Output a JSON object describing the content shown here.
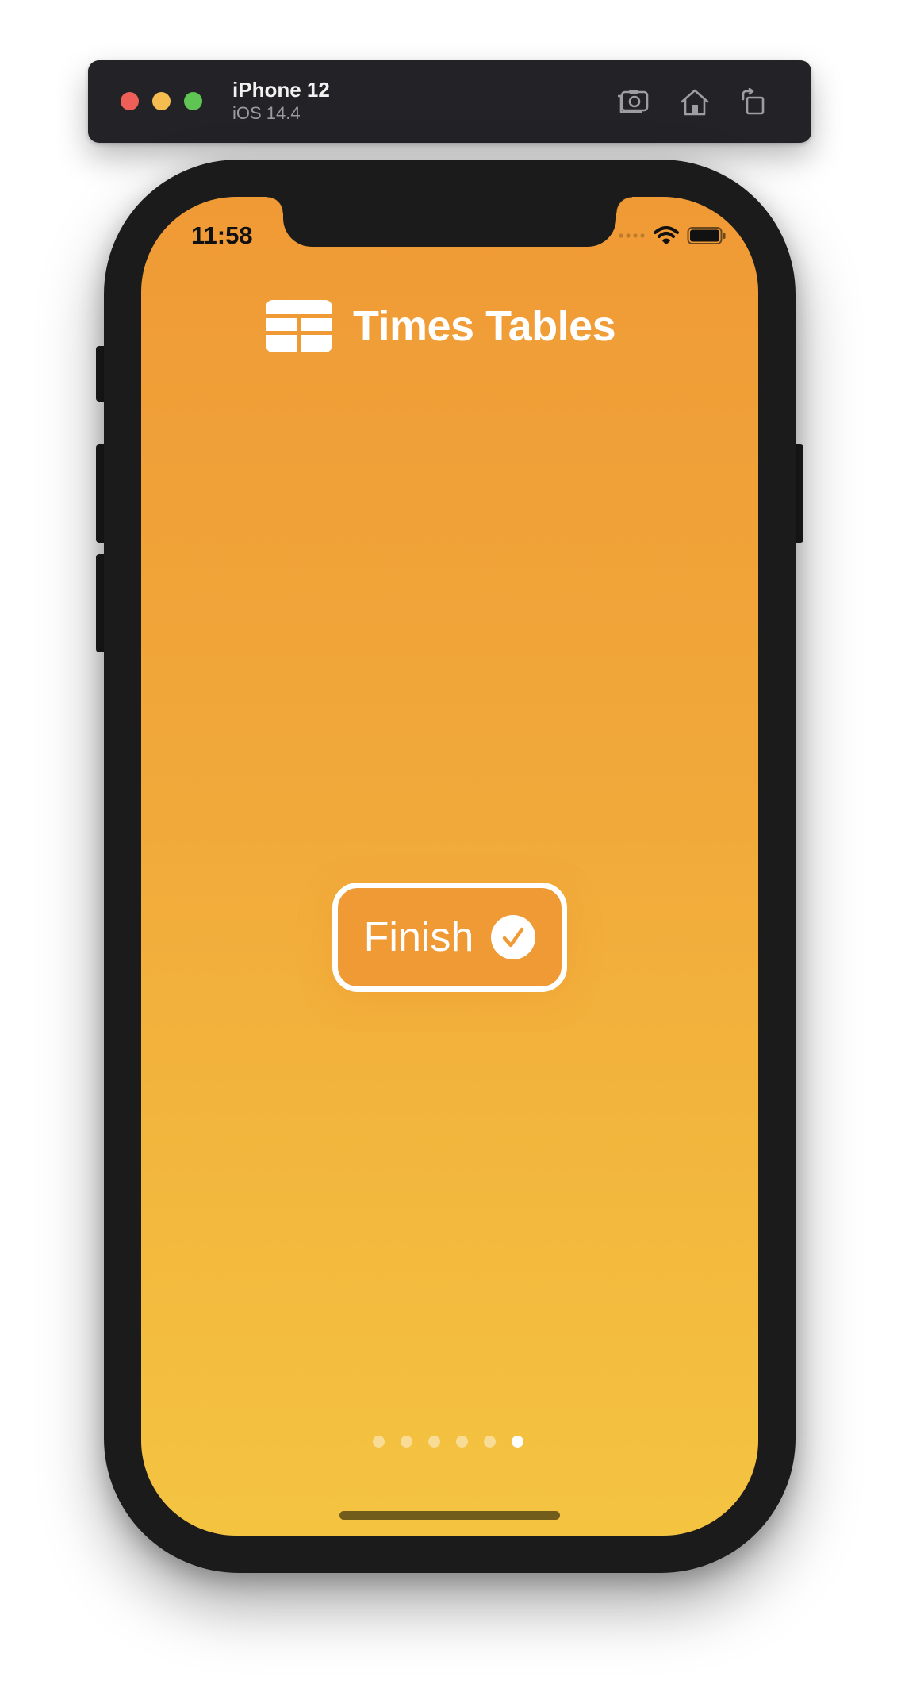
{
  "simulator": {
    "device_name": "iPhone 12",
    "os_version": "iOS 14.4",
    "traffic_lights": {
      "close_color": "#ee5f57",
      "minimize_color": "#f5bd4f",
      "zoom_color": "#5fc453"
    },
    "toolbar_icons": [
      "screenshot-icon",
      "home-icon",
      "rotate-icon"
    ]
  },
  "status_bar": {
    "time": "11:58",
    "icons": [
      "cellular-dots-icon",
      "wifi-icon",
      "battery-icon"
    ]
  },
  "app": {
    "title": "Times Tables",
    "logo_icon": "grid-table-icon",
    "gradient_top": "#f09a36",
    "gradient_bottom": "#f4c441"
  },
  "finish_button": {
    "label": "Finish",
    "icon": "checkmark-circle-icon"
  },
  "pagination": {
    "total": 6,
    "current": 6
  }
}
